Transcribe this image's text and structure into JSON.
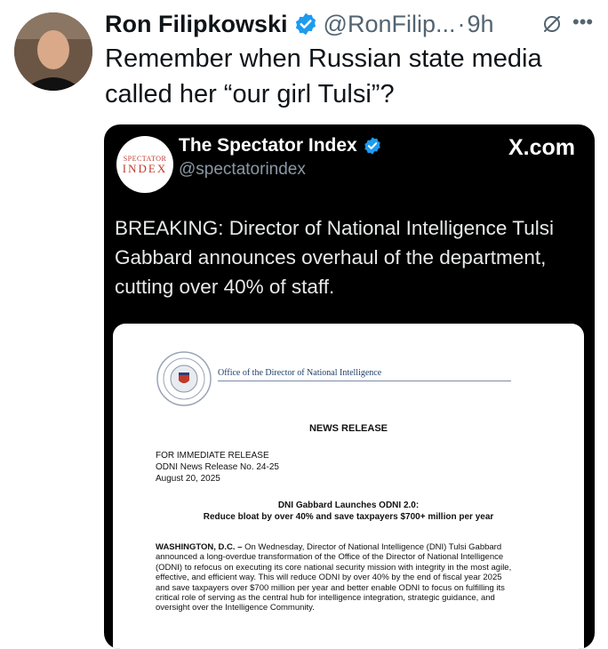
{
  "tweet": {
    "author_name": "Ron Filipkowski",
    "handle": "@RonFilip...",
    "separator": "·",
    "time": "9h",
    "text_lines": [
      "Remember when Russian state media",
      "called her “our girl Tulsi”?"
    ]
  },
  "quoted": {
    "author_name": "The Spectator Index",
    "handle": "@spectatorindex",
    "site": "X.com",
    "avatar_line1": "SPECTATOR",
    "avatar_line2": "INDEX",
    "text_lines": [
      "BREAKING: Director of National Intelligence Tulsi",
      "Gabbard announces overhaul of the department,",
      "cutting over 40% of staff."
    ]
  },
  "document": {
    "org": "Office of the Director of National Intelligence",
    "heading": "NEWS RELEASE",
    "meta_lines": [
      "FOR IMMEDIATE RELEASE",
      "ODNI News Release No. 24-25",
      "August 20, 2025"
    ],
    "headline_lines": [
      "DNI Gabbard Launches ODNI 2.0:",
      "Reduce bloat by over 40% and save taxpayers $700+ million per year"
    ],
    "dateline": "WASHINGTON, D.C. –",
    "body_lines": [
      " On Wednesday, Director of National Intelligence (DNI) Tulsi Gabbard",
      "announced a long-overdue transformation of the Office of the Director of National Intelligence",
      "(ODNI) to refocus on executing its core national security mission with integrity in the most agile,",
      "effective, and efficient way. This will reduce ODNI by over 40% by the end of fiscal year 2025",
      "and save taxpayers over $700 million per year and better enable ODNI to focus on fulfilling its",
      "critical role of serving as the central hub for intelligence integration, strategic guidance, and",
      "oversight over the Intelligence Community."
    ]
  },
  "colors": {
    "verified": "#1d9bf0",
    "muted": "#536471"
  },
  "icons": {
    "verified": "verified-badge-icon",
    "grok": "grok-icon",
    "more": "more-icon"
  }
}
